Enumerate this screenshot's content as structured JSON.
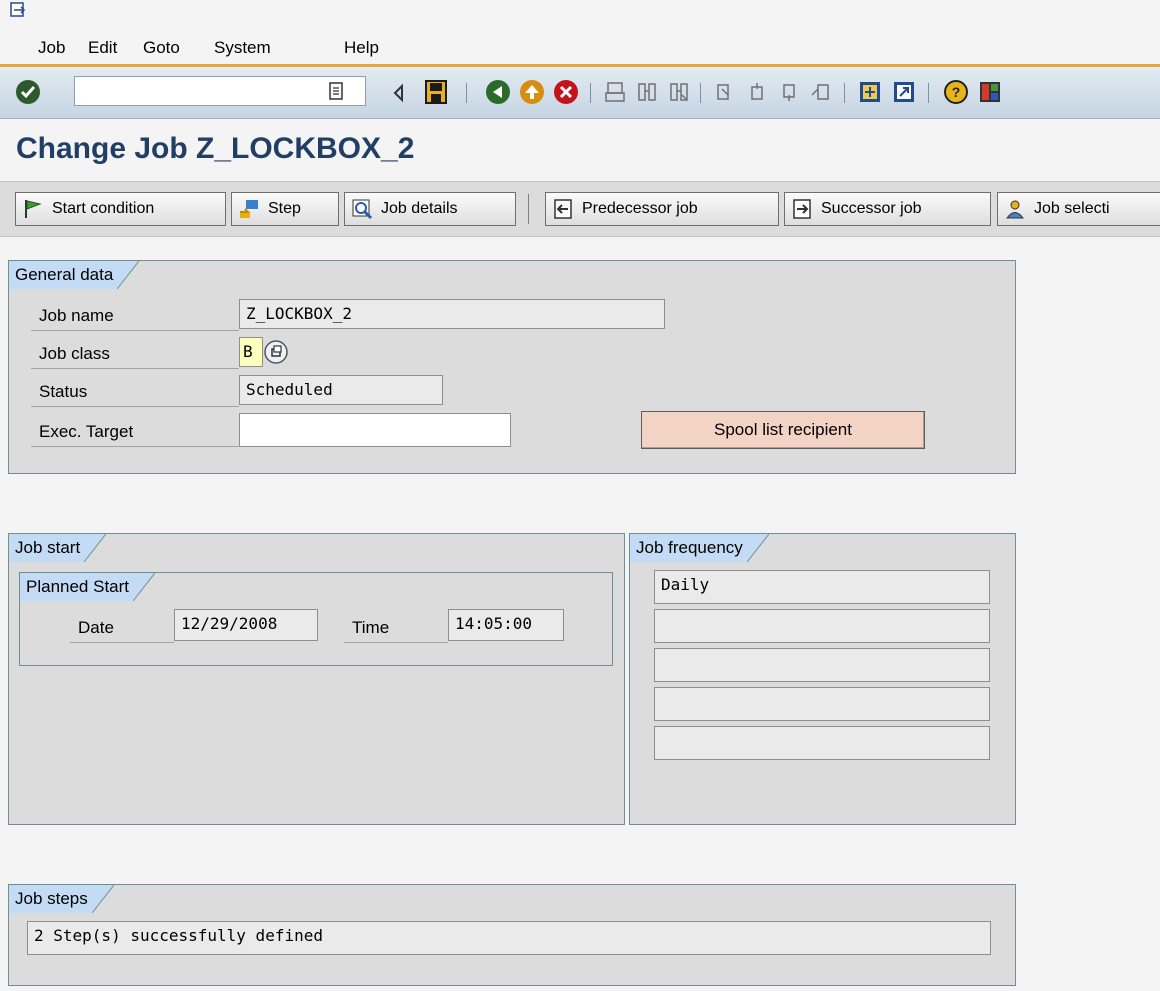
{
  "menu": {
    "items": [
      {
        "label": "Job"
      },
      {
        "label": "Edit"
      },
      {
        "label": "Goto"
      },
      {
        "label": "System"
      },
      {
        "label": "Help"
      }
    ]
  },
  "toolbar": {
    "command_field_value": "",
    "icons": [
      "enter-icon",
      "command-field-history-icon",
      "collapse-icon",
      "save-icon",
      "back-icon",
      "exit-icon",
      "cancel-icon",
      "print-icon",
      "find-icon",
      "find-next-icon",
      "first-page-icon",
      "previous-page-icon",
      "next-page-icon",
      "last-page-icon",
      "create-session-icon",
      "generate-shortcut-icon",
      "help-icon",
      "customize-layout-icon"
    ]
  },
  "title": "Change Job Z_LOCKBOX_2",
  "app_toolbar": {
    "start_condition": "Start condition",
    "step": "Step",
    "job_details": "Job details",
    "predecessor_job": "Predecessor job",
    "successor_job": "Successor job",
    "job_selection": "Job selecti"
  },
  "general_data": {
    "title": "General data",
    "job_name_label": "Job name",
    "job_name_value": "Z_LOCKBOX_2",
    "job_class_label": "Job class",
    "job_class_value": "B",
    "status_label": "Status",
    "status_value": "Scheduled",
    "exec_target_label": "Exec. Target",
    "exec_target_value": "",
    "spool_button": "Spool list recipient"
  },
  "job_start": {
    "title": "Job start",
    "planned_start_title": "Planned Start",
    "date_label": "Date",
    "date_value": "12/29/2008",
    "time_label": "Time",
    "time_value": "14:05:00"
  },
  "job_frequency": {
    "title": "Job frequency",
    "rows": [
      "Daily",
      "",
      "",
      "",
      ""
    ]
  },
  "job_steps": {
    "title": "Job steps",
    "value": "2 Step(s) successfully defined"
  },
  "colors": {
    "menu_underline_accent": "#e8a33a",
    "title": "#213e64",
    "tab_title_bg": "#c4dbf5",
    "spool_button_bg": "#f2d3c4"
  }
}
